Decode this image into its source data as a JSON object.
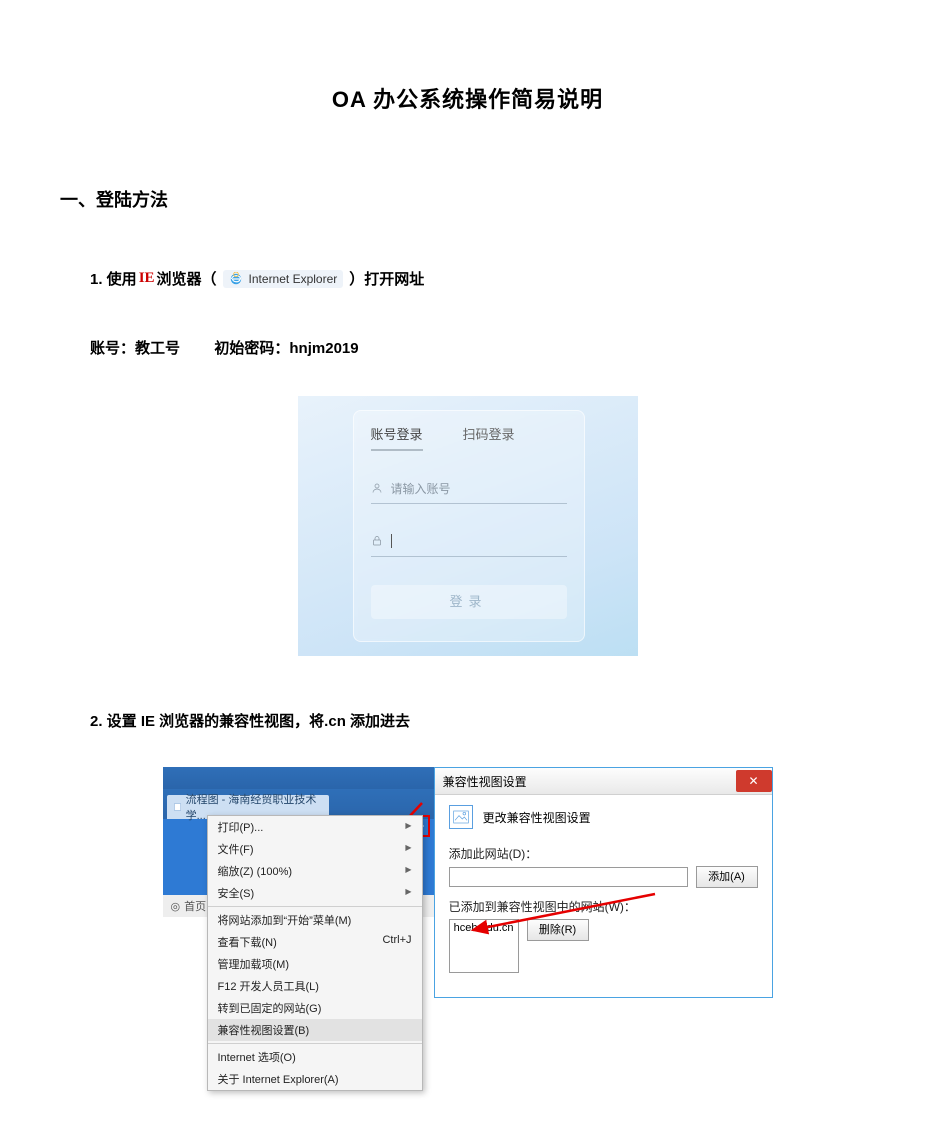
{
  "title": "OA 办公系统操作简易说明",
  "section1": "一、登陆方法",
  "step1": {
    "prefix": "1. 使用 ",
    "ie_kw": "IE",
    "mid1": " 浏览器（",
    "badge": "Internet Explorer",
    "mid2": "）打开网址"
  },
  "cred": {
    "acct_label": "账号：",
    "acct_value": "教工号",
    "pwd_label": "初始密码：",
    "pwd_value": "hnjm2019"
  },
  "login": {
    "tab1": "账号登录",
    "tab2": "扫码登录",
    "placeholder": "请输入账号",
    "btn": "登录"
  },
  "step2": "2. 设置 IE 浏览器的兼容性视图，将.cn 添加进去",
  "ie_left": {
    "tab_title": "流程图 - 海南经贸职业技术学...",
    "home": "首页"
  },
  "menu": {
    "items": [
      {
        "label": "打印(P)...",
        "sub": true
      },
      {
        "label": "文件(F)",
        "sub": true
      },
      {
        "label": "缩放(Z) (100%)",
        "sub": true
      },
      {
        "label": "安全(S)",
        "sub": true
      }
    ],
    "items2": [
      {
        "label": "将网站添加到“开始”菜单(M)"
      },
      {
        "label": "查看下载(N)",
        "accel": "Ctrl+J"
      },
      {
        "label": "管理加载项(M)"
      },
      {
        "label": "F12 开发人员工具(L)"
      },
      {
        "label": "转到已固定的网站(G)"
      },
      {
        "label": "兼容性视图设置(B)",
        "hl": true
      }
    ],
    "items3": [
      {
        "label": "Internet 选项(O)"
      },
      {
        "label": "关于 Internet Explorer(A)"
      }
    ]
  },
  "dlg": {
    "title": "兼容性视图设置",
    "heading": "更改兼容性视图设置",
    "add_label": "添加此网站(D)：",
    "add_btn": "添加(A)",
    "list_label": "已添加到兼容性视图中的网站(W)：",
    "list_item": "hceb.edu.cn",
    "del_btn": "删除(R)"
  }
}
